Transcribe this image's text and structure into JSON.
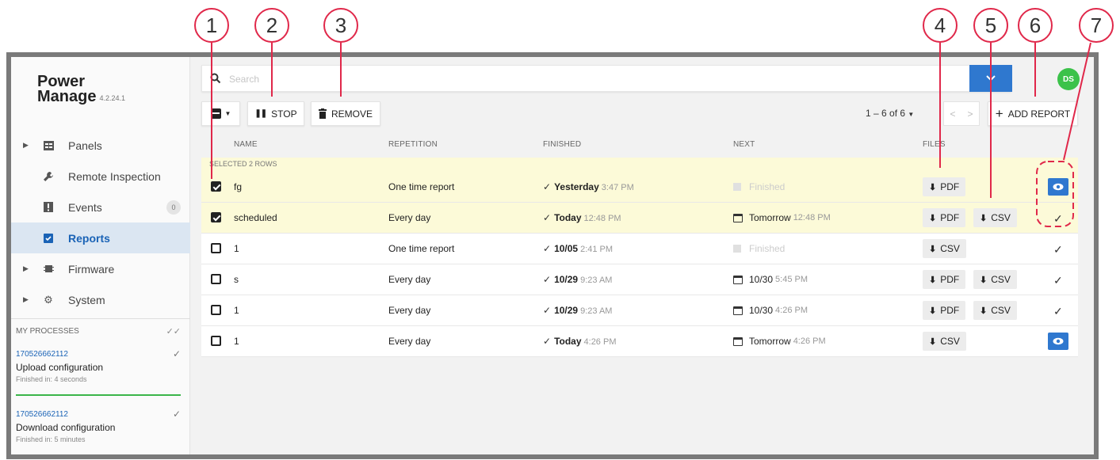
{
  "callouts": [
    "1",
    "2",
    "3",
    "4",
    "5",
    "6",
    "7"
  ],
  "colors": {
    "accent": "#2f78cf",
    "callout": "#e0284a",
    "selected_row": "#fcfad8",
    "success": "#3cc24a"
  },
  "app": {
    "title_line1": "Power",
    "title_line2": "Manage",
    "version": "4.2.24.1"
  },
  "sidebar": {
    "items": [
      {
        "label": "Panels",
        "icon": "panel-icon"
      },
      {
        "label": "Remote Inspection",
        "icon": "wrench-icon"
      },
      {
        "label": "Events",
        "icon": "alert-icon",
        "count": "0"
      },
      {
        "label": "Reports",
        "icon": "report-check-icon"
      },
      {
        "label": "Firmware",
        "icon": "chip-icon"
      },
      {
        "label": "System",
        "icon": "gear-icon"
      }
    ],
    "processes_title": "MY PROCESSES",
    "processes": [
      {
        "id": "170526662112",
        "title": "Upload configuration",
        "sub": "Finished in: 4 seconds"
      },
      {
        "id": "170526662112",
        "title": "Download configuration",
        "sub": "Finished in: 5 minutes"
      }
    ]
  },
  "header": {
    "search_placeholder": "Search",
    "avatar": "DS"
  },
  "toolbar": {
    "stop": "STOP",
    "remove": "REMOVE",
    "pagination": "1 – 6 of 6",
    "add_report": "ADD REPORT"
  },
  "table": {
    "columns": [
      "NAME",
      "REPETITION",
      "FINISHED",
      "NEXT",
      "FILES"
    ],
    "selected_label": "SELECTED 2 ROWS",
    "rows": [
      {
        "name": "fg",
        "rep": "One time report",
        "fin_day": "Yesterday",
        "fin_time": "3:47 PM",
        "next_day": "Finished",
        "next_time": "",
        "pdf": "PDF",
        "csv": ""
      },
      {
        "name": "scheduled",
        "rep": "Every day",
        "fin_day": "Today",
        "fin_time": "12:48 PM",
        "next_day": "Tomorrow",
        "next_time": "12:48 PM",
        "pdf": "PDF",
        "csv": "CSV"
      },
      {
        "name": "1",
        "rep": "One time report",
        "fin_day": "10/05",
        "fin_time": "2:41 PM",
        "next_day": "Finished",
        "next_time": "",
        "pdf": "",
        "csv": "CSV"
      },
      {
        "name": "s",
        "rep": "Every day",
        "fin_day": "10/29",
        "fin_time": "9:23 AM",
        "next_day": "10/30",
        "next_time": "5:45 PM",
        "pdf": "PDF",
        "csv": "CSV"
      },
      {
        "name": "1",
        "rep": "Every day",
        "fin_day": "10/29",
        "fin_time": "9:23 AM",
        "next_day": "10/30",
        "next_time": "4:26 PM",
        "pdf": "PDF",
        "csv": "CSV"
      },
      {
        "name": "1",
        "rep": "Every day",
        "fin_day": "Today",
        "fin_time": "4:26 PM",
        "next_day": "Tomorrow",
        "next_time": "4:26 PM",
        "pdf": "",
        "csv": "CSV"
      }
    ]
  }
}
